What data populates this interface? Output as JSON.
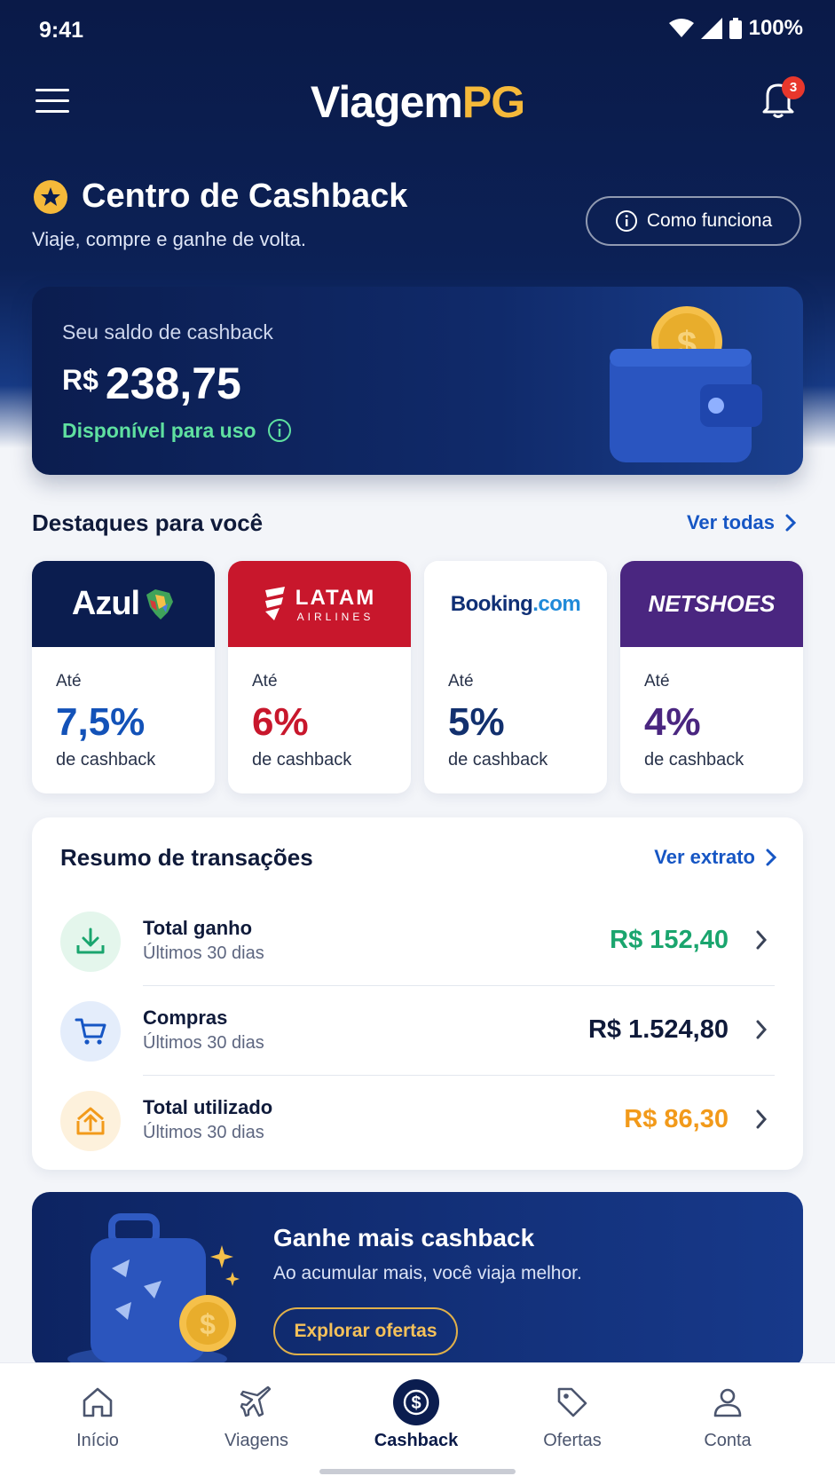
{
  "status": {
    "time": "9:41",
    "battery": "100%"
  },
  "header": {
    "logo_part1": "Viagem",
    "logo_part2": "PG",
    "notifications_count": "3"
  },
  "section": {
    "title": "Centro de Cashback",
    "subtitle": "Viaje, compre e ganhe de volta.",
    "how_it_works": "Como funciona"
  },
  "balance": {
    "label": "Seu saldo de cashback",
    "currency": "R$",
    "amount": "238,75",
    "status": "Disponível para uso"
  },
  "highlights": {
    "title": "Destaques para você",
    "see_all": "Ver todas",
    "partners": [
      {
        "brand": "Azul",
        "upto": "Até",
        "rate": "7,5%",
        "desc": "de cashback",
        "color": "#1352b8",
        "header_bg": "#0b1d4f"
      },
      {
        "brand": "LATAM",
        "brand_sub": "AIRLINES",
        "upto": "Até",
        "rate": "6%",
        "desc": "de cashback",
        "color": "#c8172c",
        "header_bg": "#c8172c"
      },
      {
        "brand_part1": "Booking",
        "brand_part2": ".com",
        "upto": "Até",
        "rate": "5%",
        "desc": "de cashback",
        "color": "#12306e",
        "header_bg": "#ffffff"
      },
      {
        "brand": "NETSHOES",
        "upto": "Até",
        "rate": "4%",
        "desc": "de cashback",
        "color": "#4a2680",
        "header_bg": "#4a2680"
      }
    ]
  },
  "transactions": {
    "title": "Resumo de transações",
    "link": "Ver extrato",
    "rows": [
      {
        "name": "Total ganho",
        "period": "Últimos 30 dias",
        "amount": "R$ 152,40",
        "color": "#1aa56e",
        "icon": "download-icon"
      },
      {
        "name": "Compras",
        "period": "Últimos 30 dias",
        "amount": "R$ 1.524,80",
        "color": "#0f1a3a",
        "icon": "cart-icon"
      },
      {
        "name": "Total utilizado",
        "period": "Últimos 30 dias",
        "amount": "R$ 86,30",
        "color": "#f29a1a",
        "icon": "upload-icon"
      }
    ]
  },
  "promo": {
    "title": "Ganhe mais cashback",
    "subtitle": "Ao acumular mais, você viaja melhor.",
    "button": "Explorar ofertas"
  },
  "nav": {
    "items": [
      {
        "label": "Início",
        "icon": "home-icon"
      },
      {
        "label": "Viagens",
        "icon": "plane-icon"
      },
      {
        "label": "Cashback",
        "icon": "dollar-icon",
        "active": true
      },
      {
        "label": "Ofertas",
        "icon": "tag-icon"
      },
      {
        "label": "Conta",
        "icon": "user-icon"
      }
    ]
  }
}
